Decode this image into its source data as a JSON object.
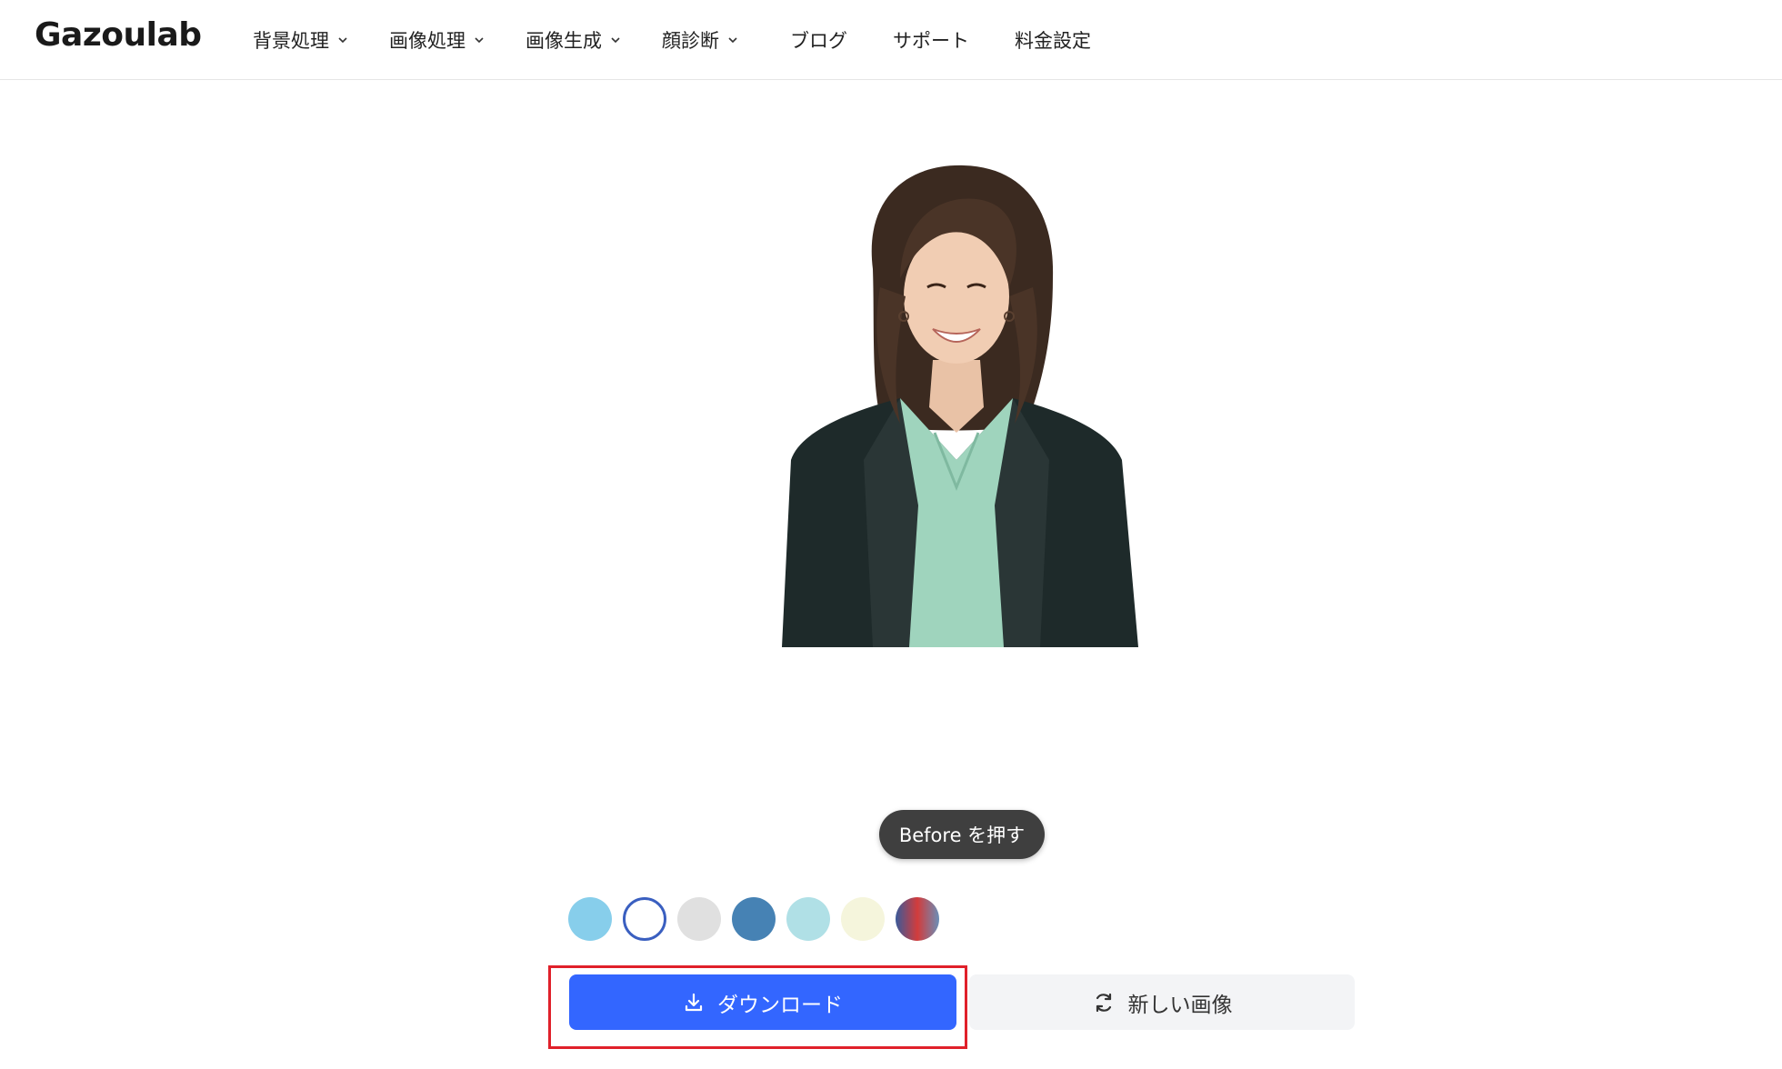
{
  "header": {
    "logo": "Gazoulab",
    "nav": [
      {
        "label": "背景処理",
        "has_dropdown": true
      },
      {
        "label": "画像処理",
        "has_dropdown": true
      },
      {
        "label": "画像生成",
        "has_dropdown": true
      },
      {
        "label": "顔診断",
        "has_dropdown": true
      },
      {
        "label": "ブログ",
        "has_dropdown": false
      },
      {
        "label": "サポート",
        "has_dropdown": false
      },
      {
        "label": "料金設定",
        "has_dropdown": false
      }
    ]
  },
  "preview": {
    "tooltip": "Before を押す"
  },
  "background_colors": [
    {
      "name": "sky-blue",
      "color": "#87ceeb",
      "selected": false
    },
    {
      "name": "white",
      "color": "#ffffff",
      "selected": true
    },
    {
      "name": "light-gray",
      "color": "#e0e0e0",
      "selected": false
    },
    {
      "name": "steel-blue",
      "color": "#4682b4",
      "selected": false
    },
    {
      "name": "powder-blue",
      "color": "#b0e0e6",
      "selected": false
    },
    {
      "name": "beige",
      "color": "#f5f5dc",
      "selected": false
    },
    {
      "name": "gradient",
      "color": "linear-gradient(90deg,#3a5a9a,#d23c3c,#6a8fb8)",
      "selected": false
    }
  ],
  "actions": {
    "download_label": "ダウンロード",
    "new_image_label": "新しい画像",
    "download_icon": "download-icon",
    "new_image_icon": "refresh-icon"
  },
  "colors": {
    "primary": "#3366ff",
    "highlight": "#e0202a",
    "tooltip_bg": "#3f3f3f"
  }
}
